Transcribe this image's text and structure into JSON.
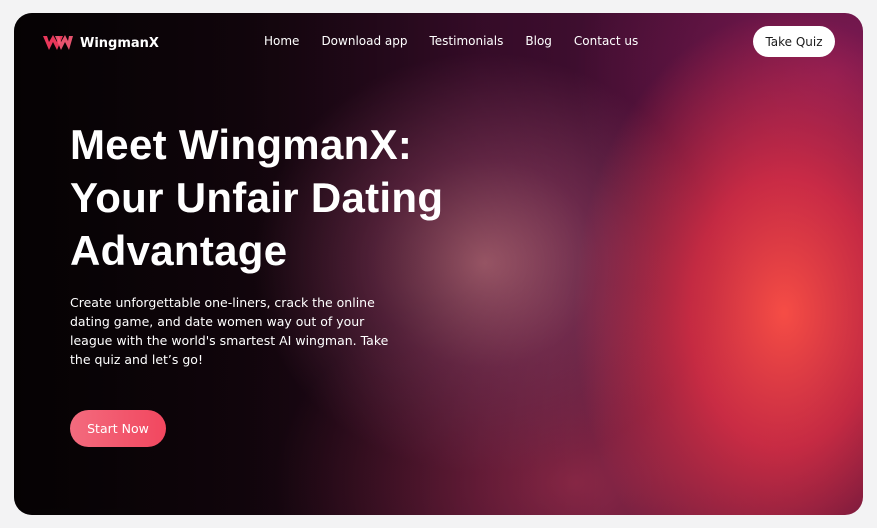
{
  "brand": {
    "name": "WingmanX",
    "logo_icon": "w-logo-icon",
    "accent": "#e8375a"
  },
  "nav": {
    "items": [
      {
        "label": "Home"
      },
      {
        "label": "Download app"
      },
      {
        "label": "Testimonials"
      },
      {
        "label": "Blog"
      },
      {
        "label": "Contact us"
      }
    ],
    "cta_label": "Take Quiz"
  },
  "hero": {
    "headline_lines": [
      "Meet WingmanX:",
      "Your Unfair Dating",
      "Advantage"
    ],
    "description": "Create unforgettable one-liners, crack the online dating game, and date women way out of your league with the world's smartest AI wingman. Take the quiz and let’s go!",
    "cta_label": "Start Now",
    "cta_color": "#f2506a"
  }
}
